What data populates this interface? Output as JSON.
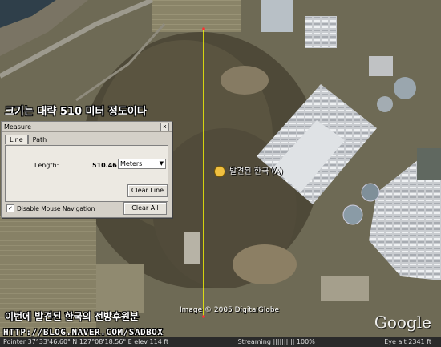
{
  "captions": {
    "top": "크기는 대략 510 미터 정도이다",
    "bottom": "이번에 발견된 한국의 전방후원분",
    "blog_url": "HTTP://BLOG.NAVER.COM/SADBOX",
    "copyright": "Image © 2005 DigitalGlobe",
    "google_logo": "Google"
  },
  "placemark": {
    "icon": "placemark-icon",
    "label": "발견된 한국 (A)"
  },
  "measure_dialog": {
    "title": "Measure",
    "close_glyph": "x",
    "tabs": [
      "Line",
      "Path"
    ],
    "active_tab": "Line",
    "length_label": "Length:",
    "length_value": "510.46",
    "units_selected": "Meters",
    "clear_line_label": "Clear Line",
    "clear_all_label": "Clear All",
    "disable_nav_label": "Disable Mouse Navigation",
    "disable_nav_checked": true
  },
  "statusbar": {
    "pointer": "Pointer 37°33'46.60\" N 127°08'18.56\" E elev 114 ft",
    "streaming": "Streaming |||||||||| 100%",
    "eye_alt": "Eye alt 2341 ft"
  },
  "colors": {
    "measure_line": "#ffff00",
    "terrain": "#6b6650"
  }
}
